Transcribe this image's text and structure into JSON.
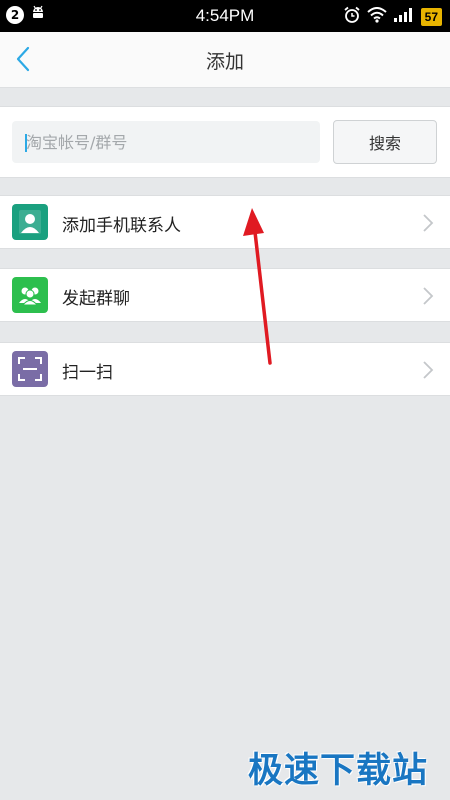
{
  "status_bar": {
    "notification_count": "2",
    "time": "4:54PM",
    "battery": "57",
    "icons": [
      "notification-badge-icon",
      "android-icon",
      "alarm-icon",
      "wifi-icon",
      "signal-icon",
      "battery-icon"
    ]
  },
  "nav": {
    "title": "添加",
    "back_icon": "chevron-left-icon"
  },
  "search": {
    "placeholder": "淘宝帐号/群号",
    "value": "",
    "button_label": "搜索"
  },
  "menu": {
    "items": [
      {
        "label": "添加手机联系人",
        "icon": "contact-person-icon",
        "color": "#1aa07f"
      },
      {
        "label": "发起群聊",
        "icon": "group-chat-icon",
        "color": "#2dbf4e"
      },
      {
        "label": "扫一扫",
        "icon": "scan-icon",
        "color": "#7a6da6"
      }
    ]
  },
  "watermark": {
    "text": "极速下载站"
  },
  "colors": {
    "accent": "#2ca9e5",
    "background": "#e6e8ea",
    "annotation_arrow": "#e01a22",
    "watermark": "#1976c2"
  }
}
